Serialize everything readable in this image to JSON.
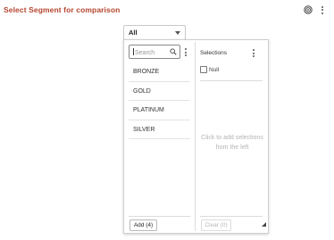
{
  "header": {
    "title": "Select Segment for comparison",
    "icons": [
      "target-icon",
      "more-vertical-icon"
    ]
  },
  "select": {
    "value": "All",
    "icon": "chevron-down-icon"
  },
  "left_pane": {
    "search_placeholder": "Search",
    "search_icon": "search-icon",
    "items": [
      {
        "label": "BRONZE"
      },
      {
        "label": "GOLD"
      },
      {
        "label": "PLATINUM"
      },
      {
        "label": "SILVER"
      }
    ],
    "add_label": "Add (4)"
  },
  "right_pane": {
    "title": "Selections",
    "null_label": "Null",
    "hint": "Click to add selections from the left",
    "clear_label": "Clear (0)"
  },
  "colors": {
    "title": "#b5452d",
    "hint_text": "#b4b4b4"
  }
}
